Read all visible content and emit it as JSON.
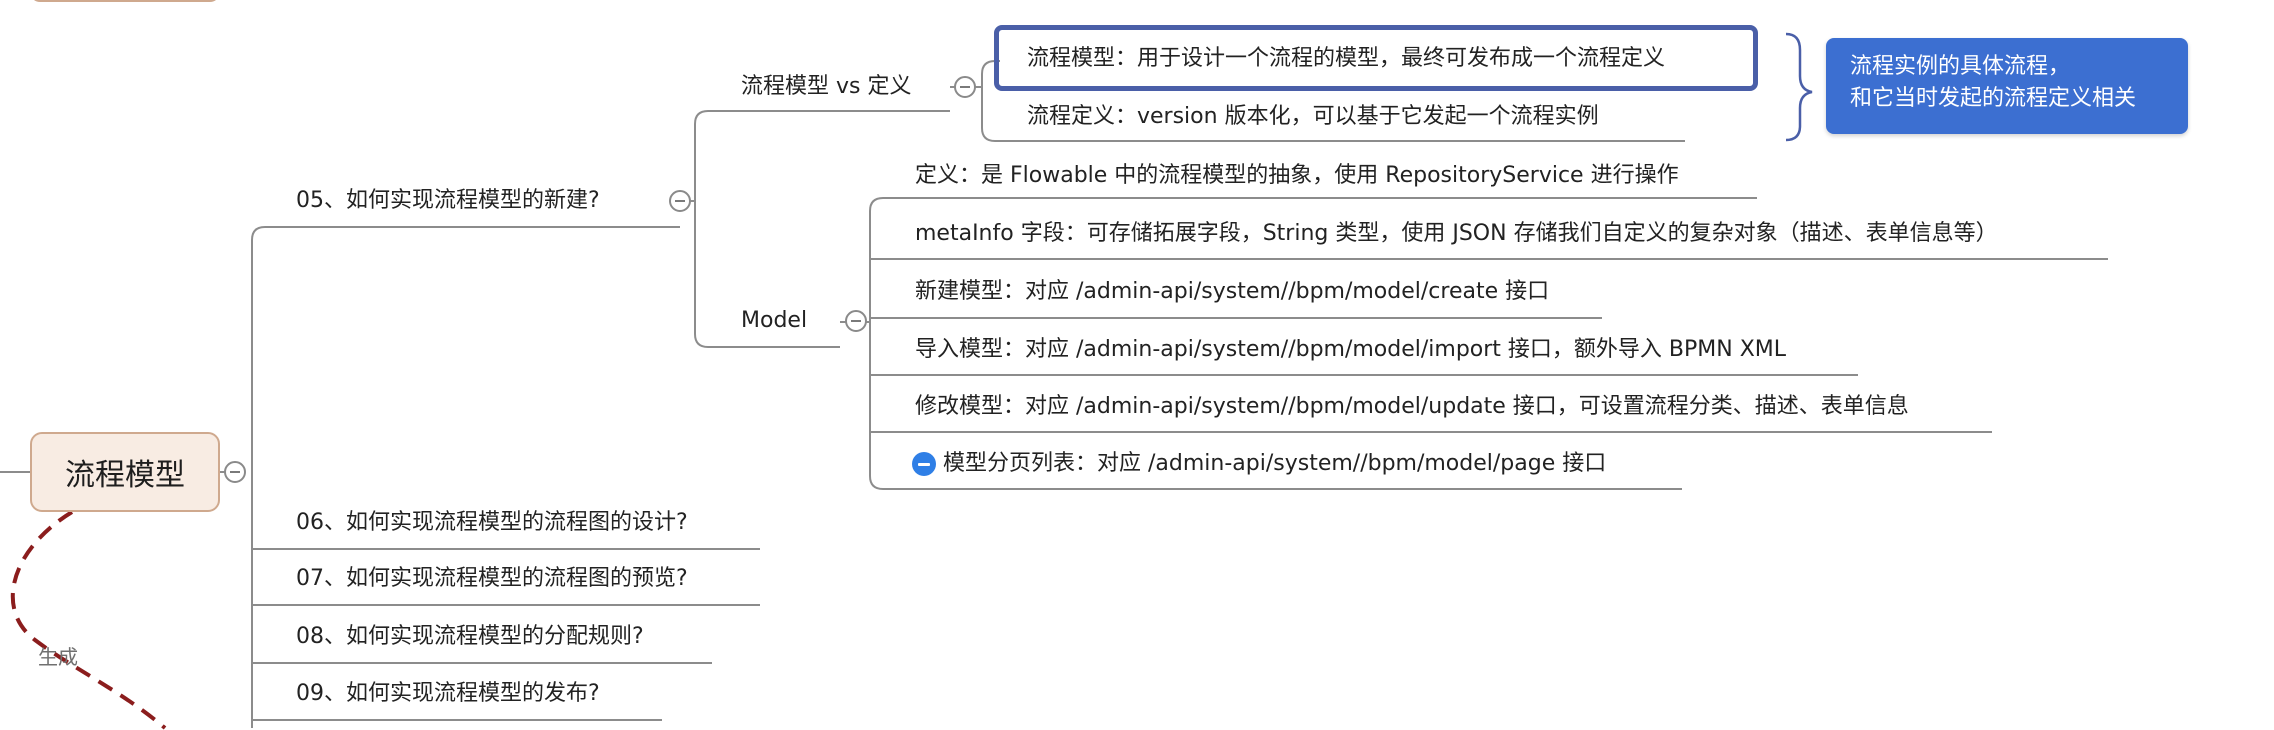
{
  "root": {
    "label": "流程模型"
  },
  "relationship_label": "生成",
  "branches": [
    {
      "label": "05、如何实现流程模型的新建?",
      "children": [
        {
          "label": "流程模型 vs 定义",
          "items": [
            "流程模型：用于设计一个流程的模型，最终可发布成一个流程定义",
            "流程定义：version 版本化，可以基于它发起一个流程实例"
          ]
        },
        {
          "label": "Model",
          "items": [
            "定义：是 Flowable 中的流程模型的抽象，使用 RepositoryService 进行操作",
            "metaInfo 字段：可存储拓展字段，String 类型，使用 JSON 存储我们自定义的复杂对象（描述、表单信息等）",
            "新建模型：对应 /admin-api/system//bpm/model/create 接口",
            "导入模型：对应 /admin-api/system//bpm/model/import 接口，额外导入 BPMN XML",
            "修改模型：对应 /admin-api/system//bpm/model/update 接口，可设置流程分类、描述、表单信息",
            "模型分页列表：对应 /admin-api/system//bpm/model/page 接口"
          ]
        }
      ]
    },
    {
      "label": "06、如何实现流程模型的流程图的设计?"
    },
    {
      "label": "07、如何实现流程模型的流程图的预览?"
    },
    {
      "label": "08、如何实现流程模型的分配规则?"
    },
    {
      "label": "09、如何实现流程模型的发布?"
    }
  ],
  "callout": {
    "lines": [
      "流程实例的具体流程，",
      "和它当时发起的流程定义相关"
    ]
  },
  "colors": {
    "line": "#8c8c8c",
    "root_fill": "#f8ece3",
    "root_border": "#cfa98e",
    "callout_fill": "#3c6fd1",
    "highlight_border": "#4a5fa8",
    "relationship": "#8b1d1d",
    "expand_icon": "#2f7fe6"
  }
}
